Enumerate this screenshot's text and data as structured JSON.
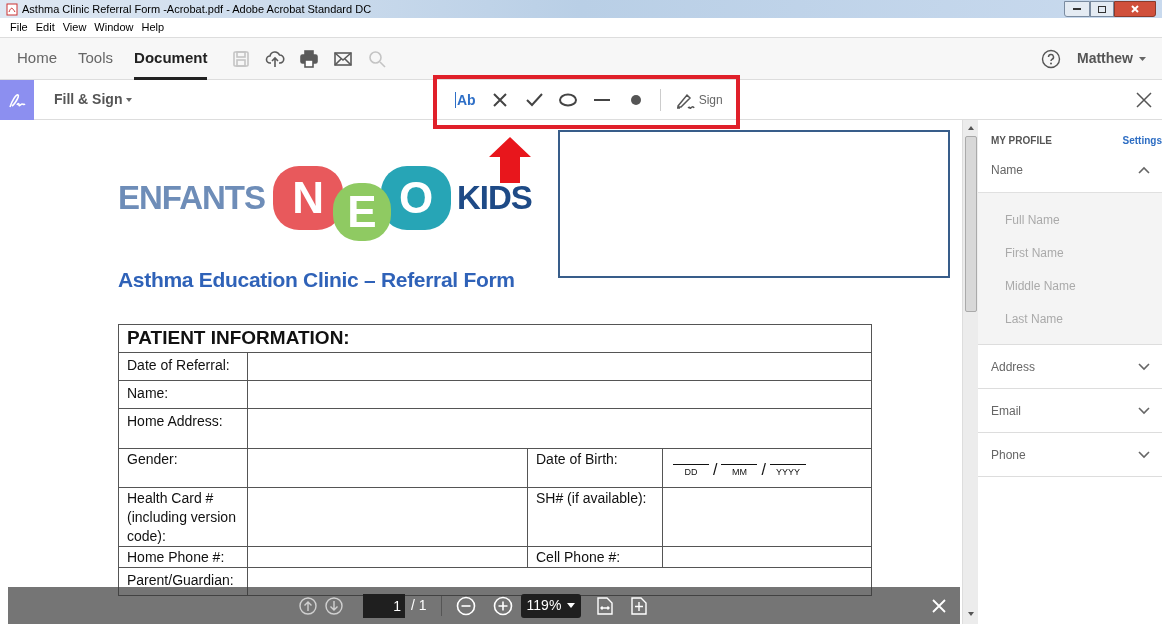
{
  "window": {
    "title": "Asthma Clinic Referral Form -Acrobat.pdf - Adobe Acrobat Standard DC"
  },
  "menu": [
    "File",
    "Edit",
    "View",
    "Window",
    "Help"
  ],
  "tabs": [
    {
      "label": "Home",
      "selected": false
    },
    {
      "label": "Tools",
      "selected": false
    },
    {
      "label": "Document",
      "selected": true
    }
  ],
  "toolbar": [
    {
      "kind": "save",
      "disabled": true
    },
    {
      "kind": "upload",
      "disabled": false
    },
    {
      "kind": "print",
      "disabled": false
    },
    {
      "kind": "mail",
      "disabled": false
    },
    {
      "kind": "search",
      "disabled": true
    }
  ],
  "user": "Matthew",
  "fill_sign": {
    "title": "Fill & Sign",
    "text_tool": "Ab",
    "tools": [
      {
        "kind": "cross"
      },
      {
        "kind": "check"
      },
      {
        "kind": "ellipse"
      },
      {
        "kind": "line"
      },
      {
        "kind": "dot"
      }
    ],
    "sign": "Sign"
  },
  "document": {
    "logo": {
      "left": "ENFANTS",
      "letters": [
        {
          "char": "N",
          "color": "#e8595c"
        },
        {
          "char": "E",
          "color": "#8fca62"
        },
        {
          "char": "O",
          "color": "#27a5b6"
        }
      ],
      "right": "KIDS"
    },
    "heading": "Asthma Education Clinic – Referral Form",
    "table": {
      "title": "PATIENT INFORMATION:",
      "rows": [
        {
          "kind": "field",
          "label": "Date of Referral:"
        },
        {
          "kind": "field",
          "label": "Name:"
        },
        {
          "kind": "area",
          "label": "Home Address:"
        },
        {
          "kind": "date",
          "label": "Gender:",
          "label2": "Date of Birth:",
          "parts": [
            "DD",
            "MM",
            "YYYY"
          ],
          "separator": "/"
        },
        {
          "kind": "split",
          "label": "Health Card # (including version code):",
          "label2": "SH# (if available):"
        },
        {
          "kind": "split",
          "label": "Home Phone #:",
          "label2": "Cell Phone #:"
        },
        {
          "kind": "field",
          "label": "Parent/Guardian:"
        }
      ]
    }
  },
  "profile": {
    "title": "MY PROFILE",
    "settings": "Settings",
    "sections": [
      {
        "label": "Name",
        "expanded": true,
        "fields": [
          "Full Name",
          "First Name",
          "Middle Name",
          "Last Name"
        ]
      },
      {
        "label": "Address",
        "expanded": false
      },
      {
        "label": "Email",
        "expanded": false
      },
      {
        "label": "Phone",
        "expanded": false
      }
    ]
  },
  "page_bar": {
    "page": "1",
    "total": "/ 1",
    "zoom": "119%"
  }
}
